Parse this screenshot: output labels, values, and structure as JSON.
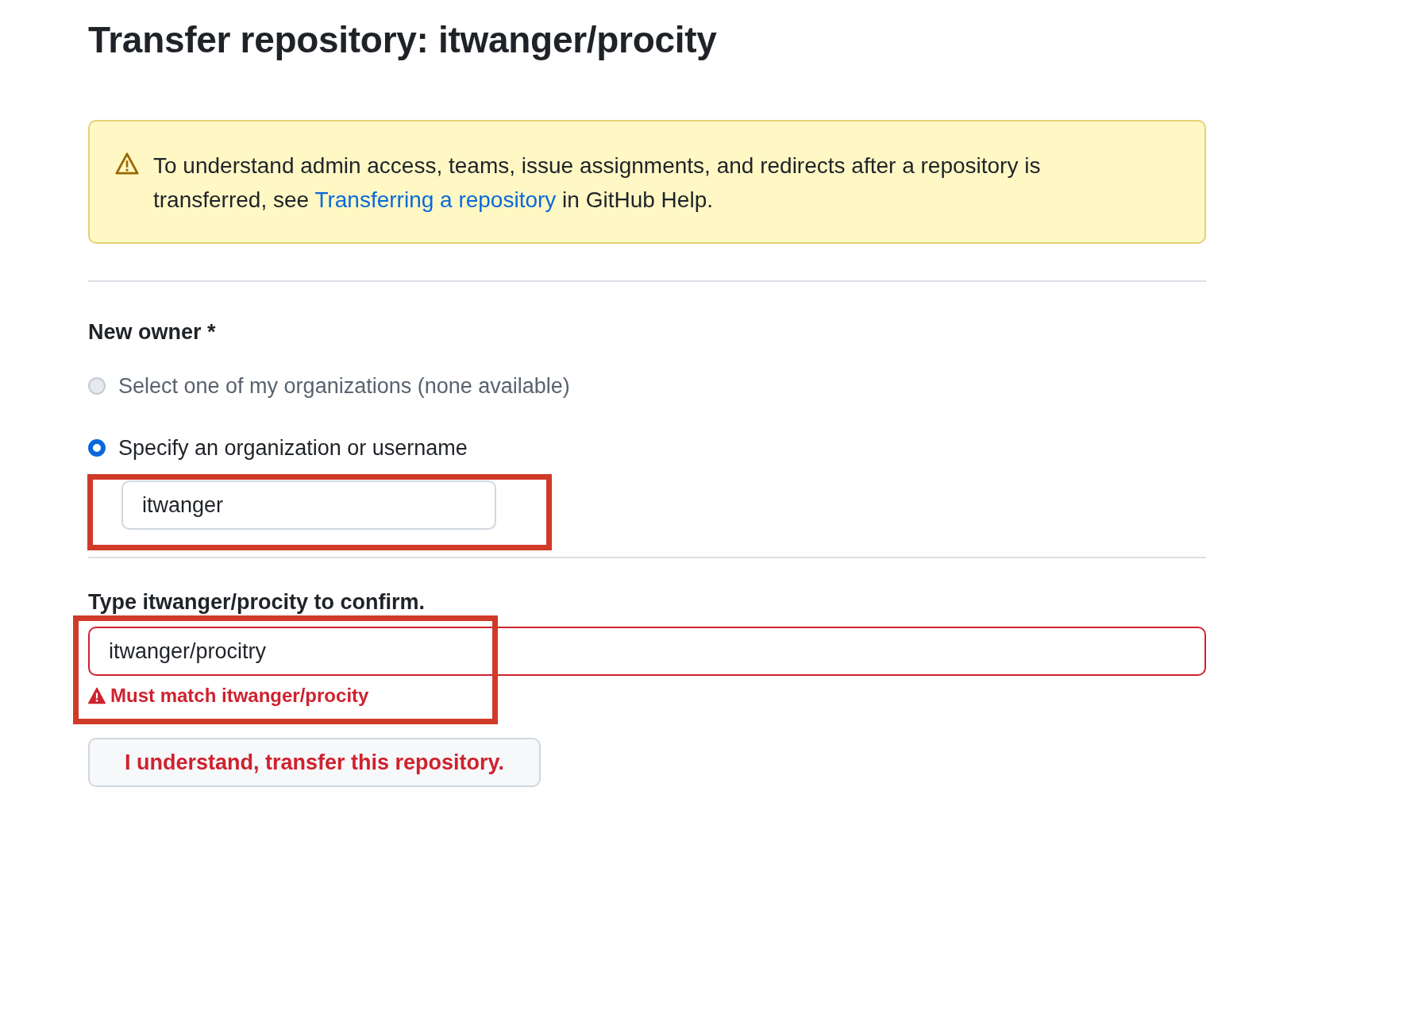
{
  "title": "Transfer repository: itwanger/procity",
  "notice": {
    "text_before": "To understand admin access, teams, issue assignments, and redirects after a repository is transferred, see ",
    "link": "Transferring a repository",
    "text_after": " in GitHub Help."
  },
  "new_owner": {
    "label": "New owner *",
    "options": [
      {
        "label": "Select one of my organizations (none available)",
        "selected": false,
        "disabled": true
      },
      {
        "label": "Specify an organization or username",
        "selected": true,
        "disabled": false
      }
    ],
    "field": {
      "value": "itwanger",
      "highlighted": true
    }
  },
  "confirm": {
    "label": "Type itwanger/procity to confirm.",
    "value": "itwanger/procitry",
    "invalid": true,
    "error": "Must match itwanger/procity",
    "highlighted": true
  },
  "button": "I understand, transfer this repository."
}
